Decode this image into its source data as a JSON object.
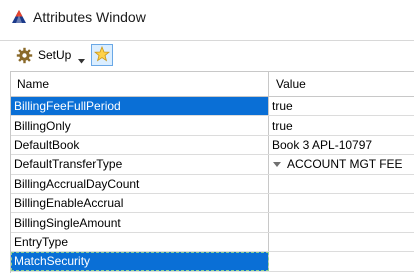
{
  "window": {
    "title": "Attributes Window",
    "app_icon": "triangle-logo-icon"
  },
  "toolbar": {
    "setup_label": "SetUp",
    "setup_icon": "gear-icon",
    "star_icon": "star-icon"
  },
  "grid": {
    "headers": {
      "name": "Name",
      "value": "Value"
    },
    "rows": [
      {
        "name": "BillingFeeFullPeriod",
        "value": "true"
      },
      {
        "name": "BillingOnly",
        "value": "true"
      },
      {
        "name": "DefaultBook",
        "value": "Book 3 APL-10797"
      },
      {
        "name": "DefaultTransferType",
        "value": "ACCOUNT MGT FEE"
      },
      {
        "name": "BillingAccrualDayCount",
        "value": ""
      },
      {
        "name": "BillingEnableAccrual",
        "value": ""
      },
      {
        "name": "BillingSingleAmount",
        "value": ""
      },
      {
        "name": "EntryType",
        "value": ""
      },
      {
        "name": "MatchSecurity",
        "value": ""
      }
    ]
  },
  "colors": {
    "selection": "#0a6fd6",
    "star_button_bg": "#dbeeff"
  }
}
